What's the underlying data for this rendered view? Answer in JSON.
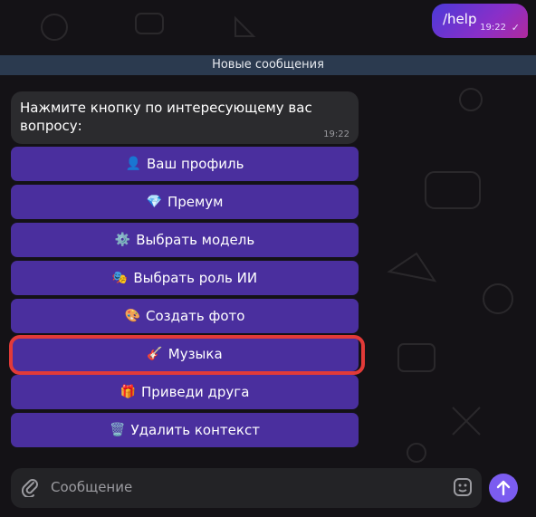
{
  "outgoing": {
    "text": "/help",
    "time": "19:22",
    "check_icon": "single-check-icon"
  },
  "new_messages_label": "Новые сообщения",
  "incoming": {
    "text": "Нажмите кнопку по интересующему вас вопросу:",
    "time": "19:22"
  },
  "keyboard": [
    {
      "icon": "👤",
      "icon_name": "profile-icon",
      "label": "Ваш профиль"
    },
    {
      "icon": "💎",
      "icon_name": "diamond-icon",
      "label": "Премум"
    },
    {
      "icon": "⚙️",
      "icon_name": "gear-icon",
      "label": "Выбрать модель"
    },
    {
      "icon": "🎭",
      "icon_name": "masks-icon",
      "label": "Выбрать роль ИИ"
    },
    {
      "icon": "🎨",
      "icon_name": "palette-icon",
      "label": "Создать фото"
    },
    {
      "icon": "🎸",
      "icon_name": "guitar-icon",
      "label": "Музыка"
    },
    {
      "icon": "🎁",
      "icon_name": "gift-icon",
      "label": "Приведи друга"
    },
    {
      "icon": "🗑️",
      "icon_name": "trash-icon",
      "label": "Удалить контекст"
    }
  ],
  "composer": {
    "placeholder": "Сообщение"
  },
  "colors": {
    "highlight": "#e23a38",
    "button_bg": "#4a2f9e",
    "send_bg": "#7b5cf0"
  }
}
